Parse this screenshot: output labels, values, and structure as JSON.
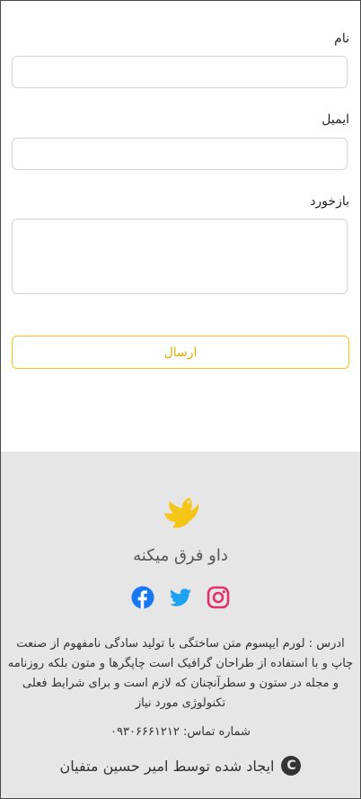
{
  "form": {
    "name_label": "نام",
    "email_label": "ایمیل",
    "feedback_label": "بازخورد",
    "name_value": "",
    "email_value": "",
    "feedback_value": "",
    "submit_label": "ارسال"
  },
  "footer": {
    "brand": "داو فرق میکنه",
    "address": "ادرس : لورم ایپسوم متن ساختگی با تولید سادگی نامفهوم از صنعت چاپ و با استفاده از طراحان گرافیک است چاپگرها و متون بلکه روزنامه و مجله در ستون و سطرآنچنان که لازم است و برای شرایط فعلی تکنولوژی مورد نیاز",
    "phone": "شماره تماس: ۰۹۳۰۶۶۶۱۲۱۲",
    "credit": "ایجاد شده توسط امیر حسین متفیان",
    "copyright_symbol": "C",
    "social": [
      "instagram-icon",
      "twitter-icon",
      "facebook-icon"
    ]
  },
  "colors": {
    "accent": "#f5c518",
    "instagram": "#e1306c",
    "twitter": "#1da1f2",
    "facebook": "#1877f2",
    "footer_bg": "#e6e6e6"
  }
}
